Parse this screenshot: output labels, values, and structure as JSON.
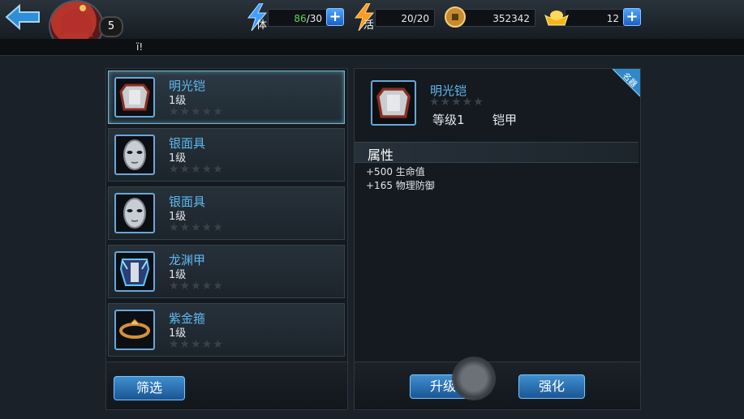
{
  "topbar": {
    "player_level": "5",
    "stamina": {
      "icon_label": "体",
      "current": "86",
      "max": "/30"
    },
    "energy": {
      "icon_label": "活",
      "value": "20/20"
    },
    "coins": {
      "value": "352342"
    },
    "ingots": {
      "value": "12"
    },
    "plus_label": "+"
  },
  "ticker": {
    "text": "ï!"
  },
  "items": [
    {
      "name": "明光铠",
      "level": "1级",
      "stars": "★★★★★",
      "icon": "armor-icon",
      "selected": true
    },
    {
      "name": "银面具",
      "level": "1级",
      "stars": "★★★★★",
      "icon": "mask-icon"
    },
    {
      "name": "银面具",
      "level": "1级",
      "stars": "★★★★★",
      "icon": "mask-icon"
    },
    {
      "name": "龙渊甲",
      "level": "1级",
      "stars": "★★★★★",
      "icon": "dragon-armor-icon"
    },
    {
      "name": "紫金箍",
      "level": "1级",
      "stars": "★★★★★",
      "icon": "headband-icon"
    }
  ],
  "detail": {
    "name": "明光铠",
    "stars": "★★★★★",
    "level": "等级1",
    "type": "铠甲",
    "ribbon": "名器",
    "attr_title": "属性",
    "attrs": [
      "+500 生命值",
      "+165 物理防御"
    ]
  },
  "buttons": {
    "filter": "筛选",
    "upgrade": "升级",
    "strengthen": "强化"
  },
  "colors": {
    "item_name": "#5fb8f0",
    "button": "#2f78b8",
    "stamina_current": "#5bd35b"
  }
}
